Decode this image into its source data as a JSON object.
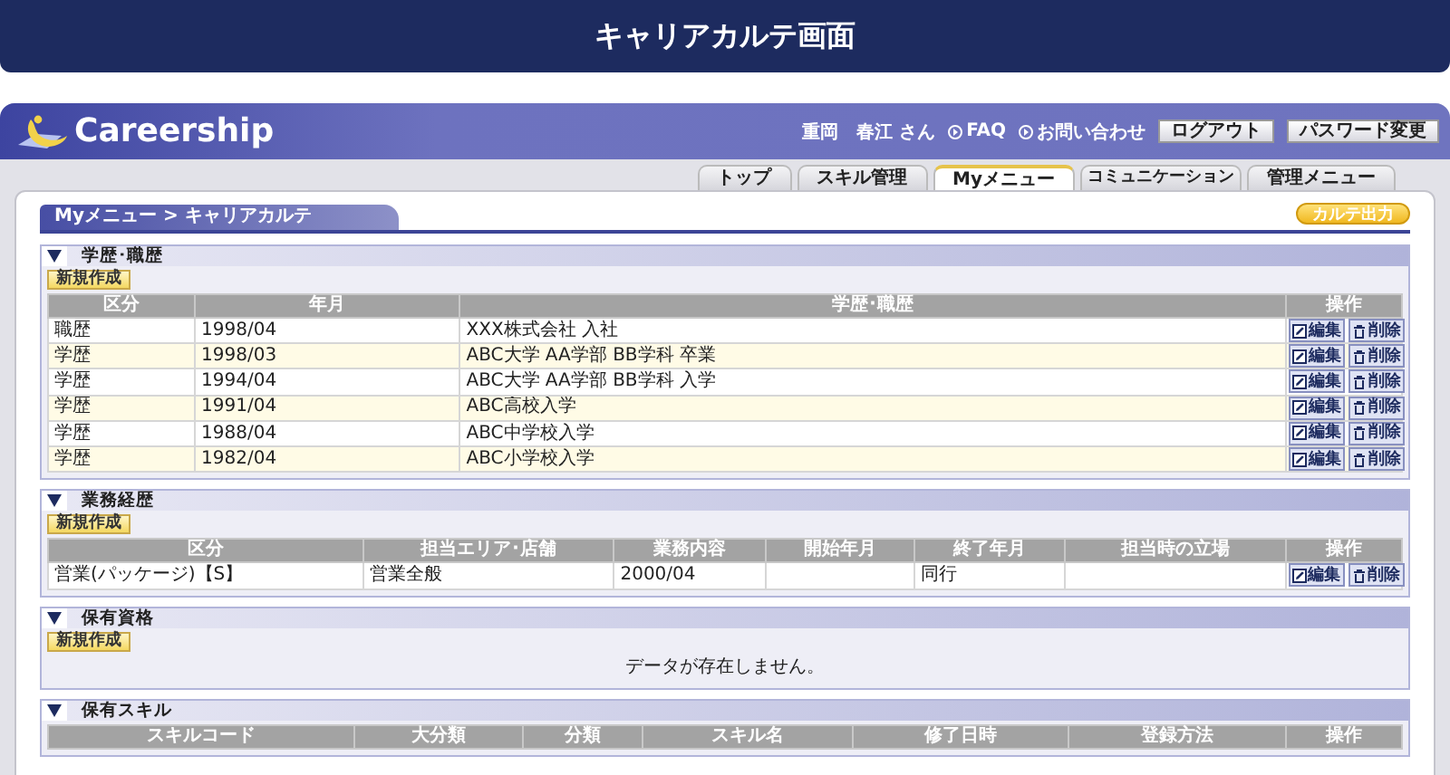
{
  "banner": {
    "title": "キャリアカルテ画面"
  },
  "header": {
    "logo": "Careership",
    "user": "重岡　春江 さん",
    "links": [
      "FAQ",
      "お問い合わせ"
    ],
    "buttons": [
      "ログアウト",
      "パスワード変更"
    ]
  },
  "tabs": [
    {
      "label": "トップ",
      "selected": false
    },
    {
      "label": "スキル管理",
      "selected": false
    },
    {
      "label": "Myメニュー",
      "selected": true
    },
    {
      "label": "コミュニケーション",
      "selected": false
    },
    {
      "label": "管理メニュー",
      "selected": false
    }
  ],
  "breadcrumb": "Myメニュー > キャリアカルテ",
  "export_button": "カルテ出力",
  "sections": [
    {
      "title": "学歴･職歴",
      "expanded": true,
      "new_button": "新規作成",
      "table": {
        "columns": [
          "区分",
          "年月",
          "学歴･職歴",
          "操作"
        ],
        "rows": [
          {
            "cells": [
              "職歴",
              "1998/04",
              "XXX株式会社 入社"
            ],
            "actions": [
              "編集",
              "削除"
            ]
          },
          {
            "cells": [
              "学歴",
              "1998/03",
              "ABC大学 AA学部 BB学科 卒業"
            ],
            "actions": [
              "編集",
              "削除"
            ]
          },
          {
            "cells": [
              "学歴",
              "1994/04",
              "ABC大学 AA学部 BB学科 入学"
            ],
            "actions": [
              "編集",
              "削除"
            ]
          },
          {
            "cells": [
              "学歴",
              "1991/04",
              "ABC高校入学"
            ],
            "actions": [
              "編集",
              "削除"
            ]
          },
          {
            "cells": [
              "学歴",
              "1988/04",
              "ABC中学校入学"
            ],
            "actions": [
              "編集",
              "削除"
            ]
          },
          {
            "cells": [
              "学歴",
              "1982/04",
              "ABC小学校入学"
            ],
            "actions": [
              "編集",
              "削除"
            ]
          }
        ]
      }
    },
    {
      "title": "業務経歴",
      "expanded": true,
      "new_button": "新規作成",
      "table": {
        "columns": [
          "区分",
          "担当エリア･店舗",
          "業務内容",
          "開始年月",
          "終了年月",
          "担当時の立場",
          "操作"
        ],
        "rows": [
          {
            "cells": [
              "営業(パッケージ)【S】",
              "営業全般",
              "2000/04",
              null,
              "同行",
              null
            ],
            "actions": [
              "編集",
              "削除"
            ]
          }
        ]
      }
    },
    {
      "title": "保有資格",
      "expanded": true,
      "new_button": "新規作成",
      "empty_message": "データが存在しません。"
    },
    {
      "title": "保有スキル",
      "expanded": true,
      "table": {
        "columns": [
          "スキルコード",
          "大分類",
          "分類",
          "スキル名",
          "修了日時",
          "登録方法",
          "操作"
        ]
      }
    }
  ]
}
